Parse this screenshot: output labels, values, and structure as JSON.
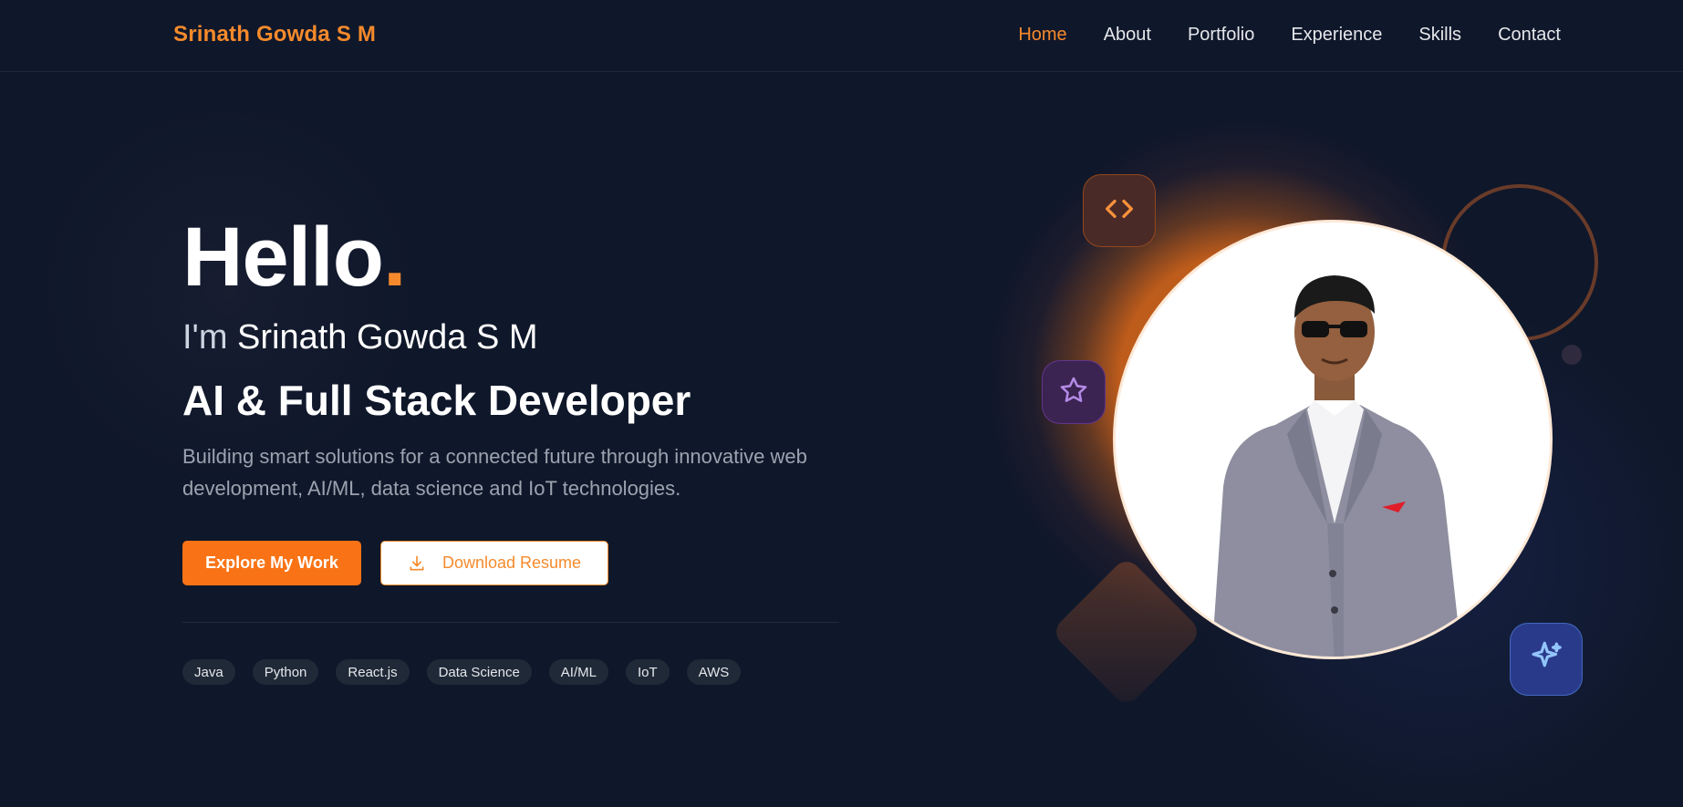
{
  "brand": {
    "name": "Srinath Gowda S M"
  },
  "nav": {
    "items": [
      {
        "label": "Home",
        "active": true
      },
      {
        "label": "About",
        "active": false
      },
      {
        "label": "Portfolio",
        "active": false
      },
      {
        "label": "Experience",
        "active": false
      },
      {
        "label": "Skills",
        "active": false
      },
      {
        "label": "Contact",
        "active": false
      }
    ]
  },
  "hero": {
    "greeting": "Hello",
    "greeting_dot": ".",
    "im_prefix": "I'm",
    "name": "Srinath Gowda S M",
    "role": "AI & Full Stack Developer",
    "description": "Building smart solutions for a connected future through innovative web development, AI/ML, data science and IoT technologies.",
    "primary_button": "Explore My Work",
    "secondary_button": "Download Resume"
  },
  "tags": [
    "Java",
    "Python",
    "React.js",
    "Data Science",
    "AI/ML",
    "IoT",
    "AWS"
  ],
  "icons": {
    "download": "download-icon",
    "code": "code-icon",
    "star": "star-icon",
    "sparkle": "sparkle-icon"
  },
  "colors": {
    "background": "#0f172a",
    "accent": "#f97316",
    "brand_text": "#f58a2c",
    "muted_text": "#9ca3af",
    "tag_background": "#1f2937"
  }
}
